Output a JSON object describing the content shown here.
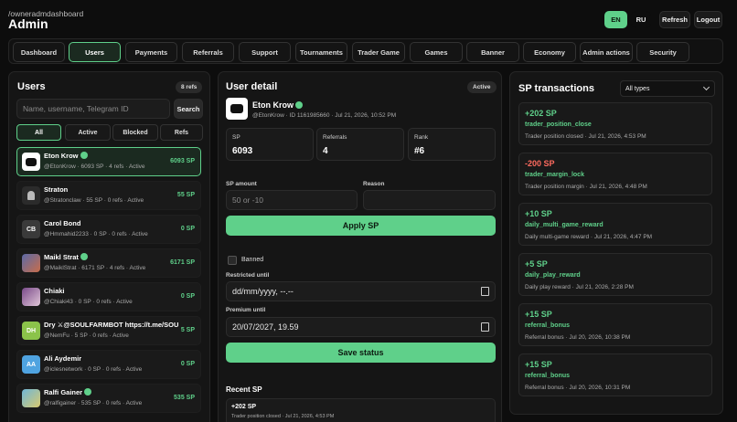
{
  "header": {
    "path": "/owneradmdashboard",
    "title": "Admin",
    "lang_en": "EN",
    "lang_ru": "RU",
    "refresh": "Refresh",
    "logout": "Logout"
  },
  "nav": [
    "Dashboard",
    "Users",
    "Payments",
    "Referrals",
    "Support",
    "Tournaments",
    "Trader Game",
    "Games",
    "Banner",
    "Economy",
    "Admin actions",
    "Security"
  ],
  "users": {
    "title": "Users",
    "count": "8 refs",
    "search_placeholder": "Name, username, Telegram ID",
    "search_button": "Search",
    "filters": [
      "All",
      "Active",
      "Blocked",
      "Refs"
    ],
    "list": [
      {
        "name": "Eton Krow",
        "sub": "@EtonKrow · 6093 SP · 4 refs · Active",
        "sp": "6093 SP",
        "initials": "",
        "color": "#ffffff",
        "verified": true
      },
      {
        "name": "Straton",
        "sub": "@Stratonclaw · 55 SP · 0 refs · Active",
        "sp": "55 SP",
        "initials": "",
        "color": "#2b2b2b",
        "verified": false
      },
      {
        "name": "Carol Bond",
        "sub": "@Hmmahid2233 · 0 SP · 0 refs · Active",
        "sp": "0 SP",
        "initials": "CB",
        "color": "#3a3a3a",
        "verified": false
      },
      {
        "name": "Maikl Strat",
        "sub": "@MaiklStrat · 6171 SP · 4 refs · Active",
        "sp": "6171 SP",
        "initials": "",
        "color": "#5b6aa8",
        "verified": true
      },
      {
        "name": "Chiaki",
        "sub": "@Chiaki43 · 0 SP · 0 refs · Active",
        "sp": "0 SP",
        "initials": "",
        "color": "#7a4a8a",
        "verified": false
      },
      {
        "name": "Dry ⚔@SOULFARMBOT https://t.me/SOU",
        "sub": "@NemFu · 5 SP · 0 refs · Active",
        "sp": "5 SP",
        "initials": "DH",
        "color": "#8bc34a",
        "verified": false
      },
      {
        "name": "Ali Aydemir",
        "sub": "@iclesnetwork · 0 SP · 0 refs · Active",
        "sp": "0 SP",
        "initials": "AA",
        "color": "#4fa3e0",
        "verified": false
      },
      {
        "name": "Ralfi Gainer",
        "sub": "@ralfigainer · 535 SP · 0 refs · Active",
        "sp": "535 SP",
        "initials": "",
        "color": "#6fb7d8",
        "verified": true
      }
    ]
  },
  "detail": {
    "title": "User detail",
    "status": "Active",
    "name": "Eton Krow",
    "meta": "@EtonKrow · ID 1161985660 · Jul 21, 2026, 10:52 PM",
    "stats": [
      {
        "label": "SP",
        "value": "6093"
      },
      {
        "label": "Referrals",
        "value": "4"
      },
      {
        "label": "Rank",
        "value": "#6"
      }
    ],
    "sp_amount_label": "SP amount",
    "sp_amount_placeholder": "50 or -10",
    "reason_label": "Reason",
    "apply": "Apply SP",
    "banned": "Banned",
    "restricted_label": "Restricted until",
    "restricted_value": "dd/mm/yyyy, --.--",
    "premium_label": "Premium until",
    "premium_value": "20/07/2027, 19.59",
    "save": "Save status",
    "recent_title": "Recent SP",
    "recent_amount": "+202 SP",
    "recent_desc": "Trader position closed · Jul 21, 2026, 4:53 PM"
  },
  "transactions": {
    "title": "SP transactions",
    "filter": "All types",
    "list": [
      {
        "amount": "+202 SP",
        "type": "trader_position_close",
        "desc": "Trader position closed · Jul 21, 2026, 4:53 PM",
        "positive": true
      },
      {
        "amount": "-200 SP",
        "type": "trader_margin_lock",
        "desc": "Trader position margin · Jul 21, 2026, 4:48 PM",
        "positive": false
      },
      {
        "amount": "+10 SP",
        "type": "daily_multi_game_reward",
        "desc": "Daily multi-game reward · Jul 21, 2026, 4:47 PM",
        "positive": true
      },
      {
        "amount": "+5 SP",
        "type": "daily_play_reward",
        "desc": "Daily play reward · Jul 21, 2026, 2:28 PM",
        "positive": true
      },
      {
        "amount": "+15 SP",
        "type": "referral_bonus",
        "desc": "Referral bonus · Jul 20, 2026, 10:38 PM",
        "positive": true
      },
      {
        "amount": "+15 SP",
        "type": "referral_bonus",
        "desc": "Referral bonus · Jul 20, 2026, 10:31 PM",
        "positive": true
      }
    ]
  },
  "colors": {
    "accent": "#5fd08a",
    "negative": "#ff6b5f"
  }
}
